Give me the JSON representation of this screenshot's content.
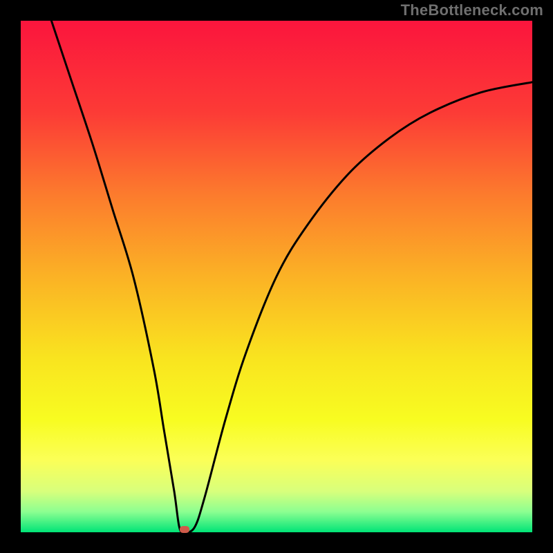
{
  "watermark": "TheBottleneck.com",
  "colors": {
    "frame": "#000000",
    "curve": "#000000",
    "marker": "#cf5b4a",
    "gradient_stops": [
      "#fb153d",
      "#fc3b36",
      "#fc7b2d",
      "#fbb225",
      "#f9e41f",
      "#f8fc21",
      "#fbff58",
      "#d8ff7c",
      "#8cff91",
      "#00e477"
    ]
  },
  "chart_data": {
    "type": "line",
    "title": "",
    "xlabel": "",
    "ylabel": "",
    "xlim": [
      0,
      100
    ],
    "ylim": [
      0,
      100
    ],
    "series": [
      {
        "name": "bottleneck-curve",
        "x": [
          6,
          10,
          14,
          18,
          22,
          26,
          28,
          30,
          31,
          32,
          34,
          36,
          40,
          44,
          50,
          56,
          64,
          72,
          80,
          90,
          100
        ],
        "y": [
          100,
          88,
          76,
          63,
          50,
          32,
          20,
          8,
          1,
          0,
          1,
          7,
          22,
          35,
          50,
          60,
          70,
          77,
          82,
          86,
          88
        ]
      }
    ],
    "marker": {
      "x": 32,
      "y": 0.5
    },
    "gradient_direction": "vertical_top_to_bottom"
  }
}
